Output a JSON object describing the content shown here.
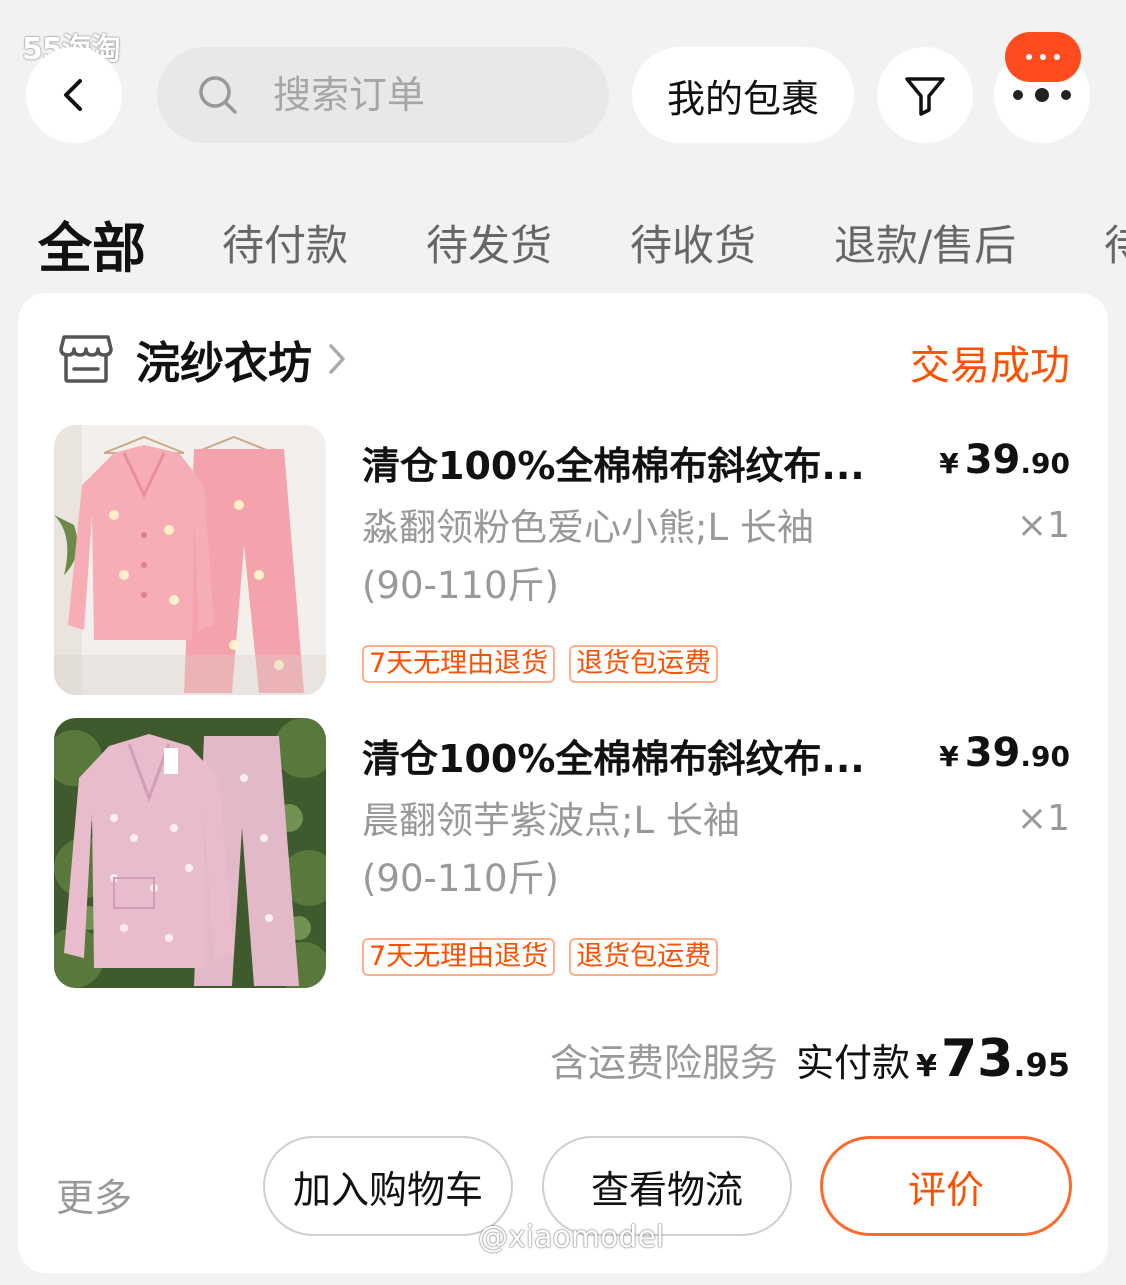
{
  "watermark": {
    "top": "55海淘",
    "bottom": "@xiaomodel"
  },
  "header": {
    "search_placeholder": "搜索订单",
    "parcel_label": "我的包裹"
  },
  "tabs": [
    "全部",
    "待付款",
    "待发货",
    "待收货",
    "退款/售后",
    "待"
  ],
  "order": {
    "shop_name": "浣纱衣坊",
    "status": "交易成功",
    "items": [
      {
        "title": "清仓100%全棉棉布斜纹布...",
        "sku_line1": "淼翻领粉色爱心小熊;L 长袖",
        "sku_line2": "(90-110斤)",
        "price_currency": "¥",
        "price_int": "39",
        "price_dec": ".90",
        "qty": "×1",
        "tags": [
          "7天无理由退货",
          "退货包运费"
        ]
      },
      {
        "title": "清仓100%全棉棉布斜纹布...",
        "sku_line1": "晨翻领芋紫波点;L 长袖",
        "sku_line2": "(90-110斤)",
        "price_currency": "¥",
        "price_int": "39",
        "price_dec": ".90",
        "qty": "×1",
        "tags": [
          "7天无理由退货",
          "退货包运费"
        ]
      }
    ],
    "total_note": "含运费险服务",
    "total_label": "实付款",
    "total_currency": "¥",
    "total_int": "73",
    "total_dec": ".95",
    "more_label": "更多",
    "buttons": {
      "cart": "加入购物车",
      "logistics": "查看物流",
      "review": "评价"
    }
  },
  "colors": {
    "accent": "#ff5000",
    "badge": "#ff4c1f",
    "page_bg": "#f2f2f2"
  }
}
